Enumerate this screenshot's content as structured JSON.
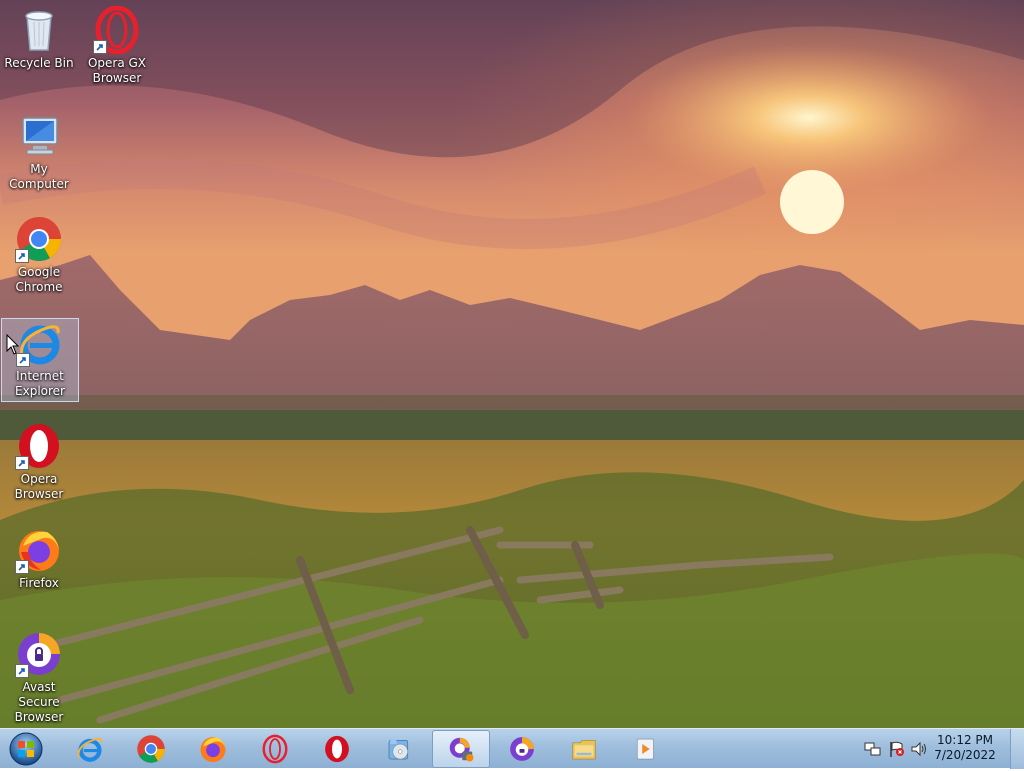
{
  "desktop": {
    "icons": [
      {
        "label": "Recycle Bin",
        "icon": "recycle-bin-icon"
      },
      {
        "label": "Opera GX\nBrowser",
        "icon": "opera-gx-icon"
      },
      {
        "label": "My Computer",
        "icon": "my-computer-icon"
      },
      {
        "label": "Google\nChrome",
        "icon": "chrome-icon"
      },
      {
        "label": "Internet\nExplorer",
        "icon": "internet-explorer-icon"
      },
      {
        "label": "Opera\nBrowser",
        "icon": "opera-icon"
      },
      {
        "label": "Firefox",
        "icon": "firefox-icon"
      },
      {
        "label": "Avast Secure\nBrowser",
        "icon": "avast-secure-browser-icon"
      }
    ],
    "selected_icon": "Internet Explorer"
  },
  "taskbar": {
    "pinned": [
      {
        "icon": "internet-explorer-icon"
      },
      {
        "icon": "chrome-icon"
      },
      {
        "icon": "firefox-icon"
      },
      {
        "icon": "opera-gx-icon"
      },
      {
        "icon": "opera-icon"
      },
      {
        "icon": "installer-disc-icon"
      },
      {
        "icon": "avast-install-icon",
        "active": true
      },
      {
        "icon": "avast-secure-browser-icon"
      },
      {
        "icon": "file-explorer-icon"
      },
      {
        "icon": "media-player-icon"
      }
    ],
    "tray": {
      "icons": [
        "network-icon",
        "action-center-flag-icon",
        "volume-icon"
      ],
      "time": "10:12 PM",
      "date": "7/20/2022"
    }
  },
  "colors": {
    "taskbar_top": "#b8d2ea",
    "taskbar_bottom": "#8db0d3",
    "sky_top": "#6e4a5c",
    "sun": "#fff4c8"
  }
}
